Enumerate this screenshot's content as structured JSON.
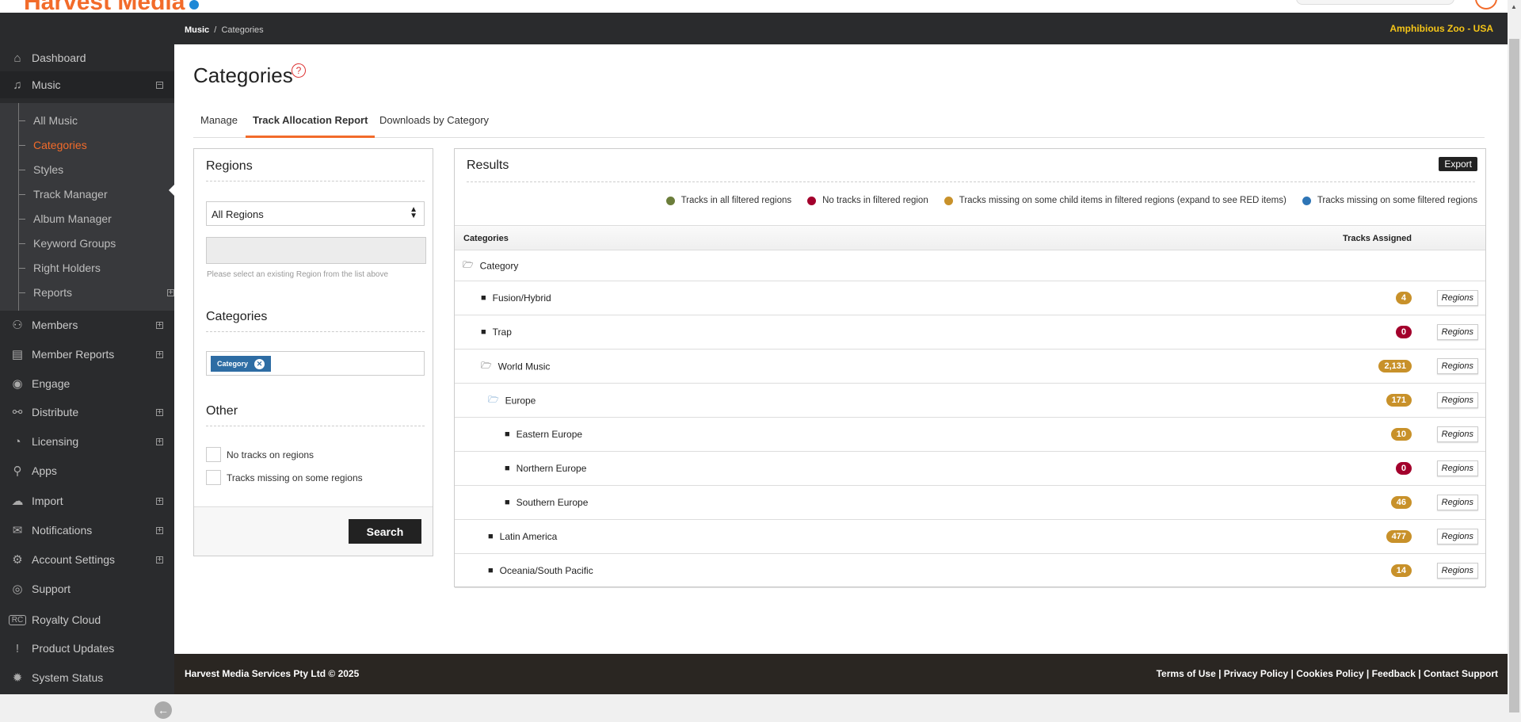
{
  "brand": {
    "logo": "Harvest Media"
  },
  "header": {
    "breadcrumb_parent": "Music",
    "breadcrumb_current": "Categories",
    "account": "Amphibious Zoo - USA"
  },
  "sidebar": {
    "items": [
      {
        "label": "Dashboard",
        "icon": "⌂",
        "name": "home-icon"
      },
      {
        "label": "Music",
        "icon": "♫",
        "name": "music-icon",
        "toggle": "⊟"
      },
      {
        "label": "Members",
        "icon": "⚇",
        "name": "members-icon",
        "toggle": "+"
      },
      {
        "label": "Member Reports",
        "icon": "▤",
        "name": "document-icon",
        "toggle": "+"
      },
      {
        "label": "Engage",
        "icon": "◉",
        "name": "target-icon"
      },
      {
        "label": "Distribute",
        "icon": "⚯",
        "name": "share-icon",
        "toggle": "+"
      },
      {
        "label": "Licensing",
        "icon": "◔",
        "name": "pie-chart-icon",
        "toggle": "+"
      },
      {
        "label": "Apps",
        "icon": "⚲",
        "name": "sitemap-icon"
      },
      {
        "label": "Import",
        "icon": "☁",
        "name": "cloud-upload-icon",
        "toggle": "+"
      },
      {
        "label": "Notifications",
        "icon": "✉",
        "name": "envelope-icon",
        "toggle": "+"
      },
      {
        "label": "Account Settings",
        "icon": "⚙",
        "name": "gear-icon",
        "toggle": "+"
      },
      {
        "label": "Support",
        "icon": "◎",
        "name": "lifebuoy-icon"
      },
      {
        "label": "Royalty Cloud",
        "icon": "RC",
        "name": "royalty-cloud-icon"
      },
      {
        "label": "Product Updates",
        "icon": "!",
        "name": "alert-icon"
      },
      {
        "label": "System Status",
        "icon": "✹",
        "name": "status-icon"
      }
    ],
    "music_sub": [
      "All Music",
      "Categories",
      "Styles",
      "Track Manager",
      "Album Manager",
      "Keyword Groups",
      "Right Holders",
      "Reports"
    ],
    "active_sub": "Categories"
  },
  "page": {
    "title": "Categories",
    "help_icon": "?",
    "tabs": [
      "Manage",
      "Track Allocation Report",
      "Downloads by Category"
    ],
    "active_tab": "Track Allocation Report"
  },
  "filters": {
    "regions_heading": "Regions",
    "regions_select": "All Regions",
    "regions_hint": "Please select an existing Region from the list above",
    "categories_heading": "Categories",
    "category_tag": "Category",
    "other_heading": "Other",
    "checkbox1": "No tracks on regions",
    "checkbox2": "Tracks missing on some regions",
    "search_label": "Search"
  },
  "results": {
    "title": "Results",
    "export_label": "Export",
    "legend": [
      {
        "label": "Tracks in all filtered regions",
        "color": "#6b7d3a"
      },
      {
        "label": "No tracks in filtered region",
        "color": "#a3002c"
      },
      {
        "label": "Tracks missing on some child items in filtered regions (expand to see RED items)",
        "color": "#c8912a"
      },
      {
        "label": "Tracks missing on some filtered regions",
        "color": "#2e75b6"
      }
    ],
    "col_categories": "Categories",
    "col_tracks": "Tracks Assigned",
    "root": "Category",
    "regions_button": "Regions",
    "rows": [
      {
        "name": "Fusion/Hybrid",
        "level": 1,
        "open": false,
        "count": "4",
        "status": "gold"
      },
      {
        "name": "Trap",
        "level": 1,
        "open": false,
        "count": "0",
        "status": "red"
      },
      {
        "name": "World Music",
        "level": 1,
        "open": true,
        "count": "2,131",
        "status": "gold"
      },
      {
        "name": "Europe",
        "level": 2,
        "open": true,
        "count": "171",
        "status": "gold"
      },
      {
        "name": "Eastern Europe",
        "level": 3,
        "open": false,
        "count": "10",
        "status": "gold"
      },
      {
        "name": "Northern Europe",
        "level": 3,
        "open": false,
        "count": "0",
        "status": "red"
      },
      {
        "name": "Southern Europe",
        "level": 3,
        "open": false,
        "count": "46",
        "status": "gold"
      },
      {
        "name": "Latin America",
        "level": 2,
        "open": false,
        "count": "477",
        "status": "gold"
      },
      {
        "name": "Oceania/South Pacific",
        "level": 2,
        "open": false,
        "count": "14",
        "status": "gold"
      }
    ]
  },
  "colors": {
    "gold": "#c8912a",
    "red": "#a3002c",
    "accent": "#f26b2a"
  },
  "footer": {
    "copyright": "Harvest Media Services Pty Ltd © 2025",
    "links": [
      "Terms of Use",
      "Privacy Policy",
      "Cookies Policy",
      "Feedback",
      "Contact Support"
    ]
  }
}
